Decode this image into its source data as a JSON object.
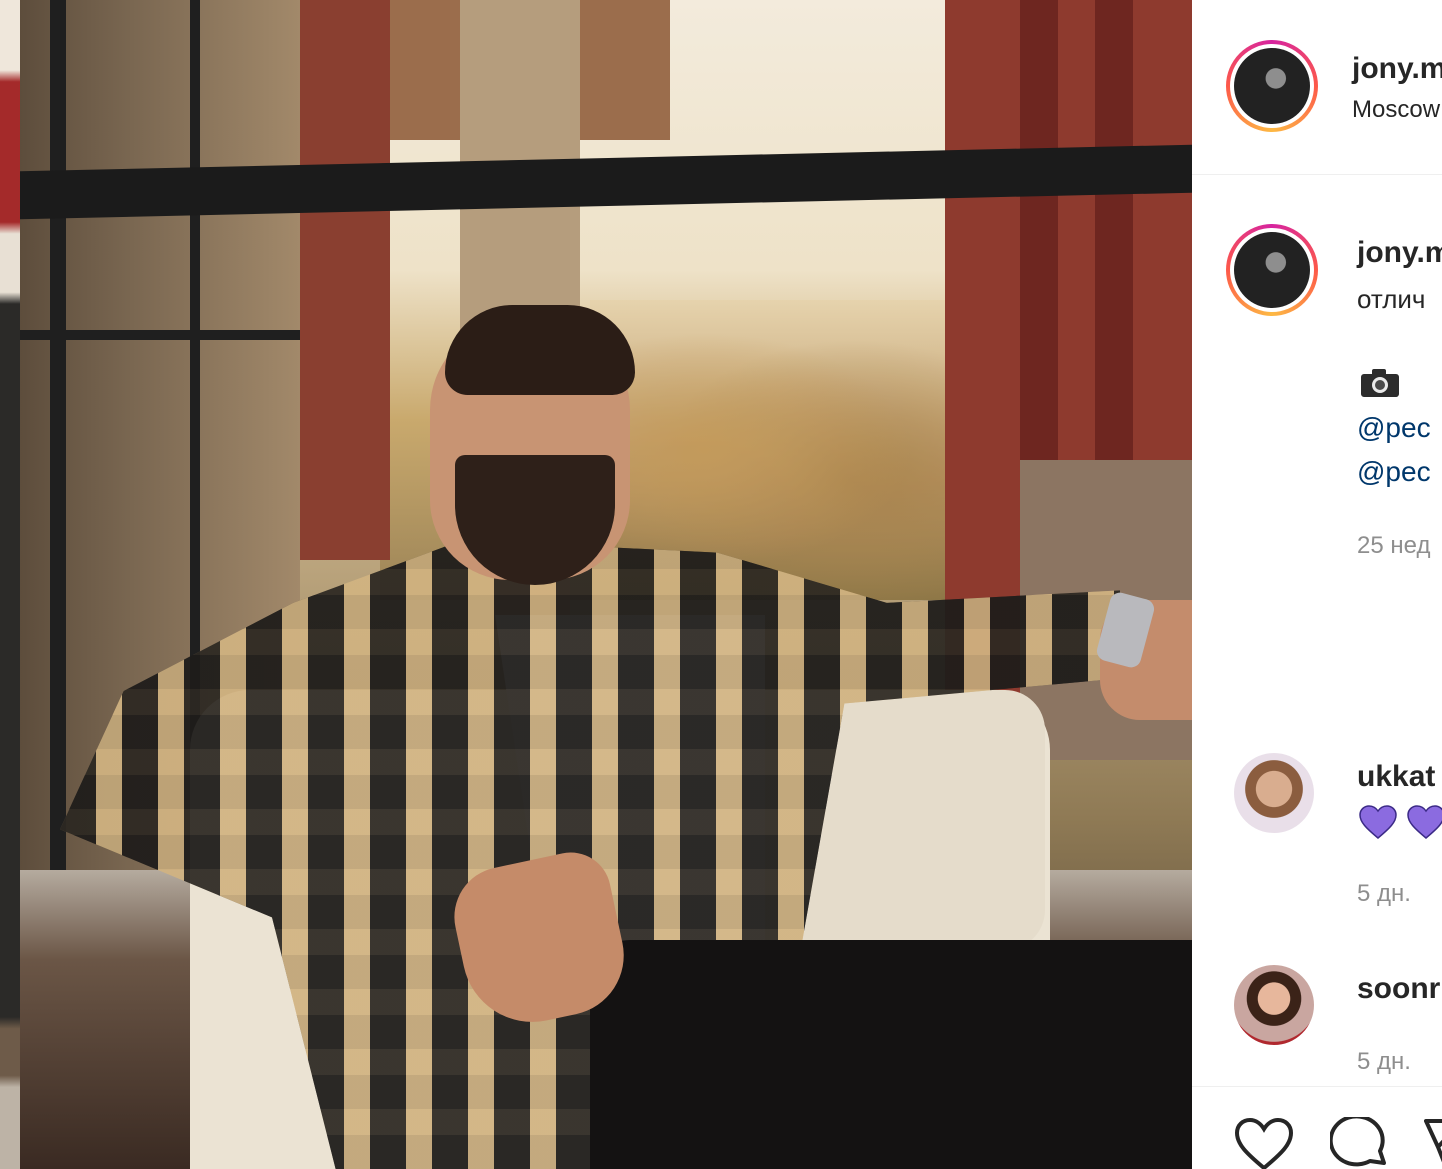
{
  "post": {
    "author": {
      "username": "jony.m",
      "location": "Moscow"
    },
    "caption": {
      "username": "jony.m",
      "text": "отлич",
      "camera_emoji": "camera-icon",
      "mentions": [
        "@pec",
        "@pec"
      ],
      "time": "25 нед"
    },
    "comments": [
      {
        "username": "ukkat",
        "hearts": [
          "purple-heart-icon",
          "purple-heart-icon"
        ],
        "time": "5 дн."
      },
      {
        "username": "soonr",
        "time": "5 дн."
      }
    ],
    "actions": [
      "like-icon",
      "comment-icon",
      "share-icon"
    ]
  },
  "colors": {
    "link": "#00376b",
    "text": "#262626",
    "muted": "#8e8e8e",
    "heart_purple": "#8b6be0",
    "ring_gradient": [
      "#d6249f",
      "#fd5949",
      "#fdb944"
    ]
  }
}
